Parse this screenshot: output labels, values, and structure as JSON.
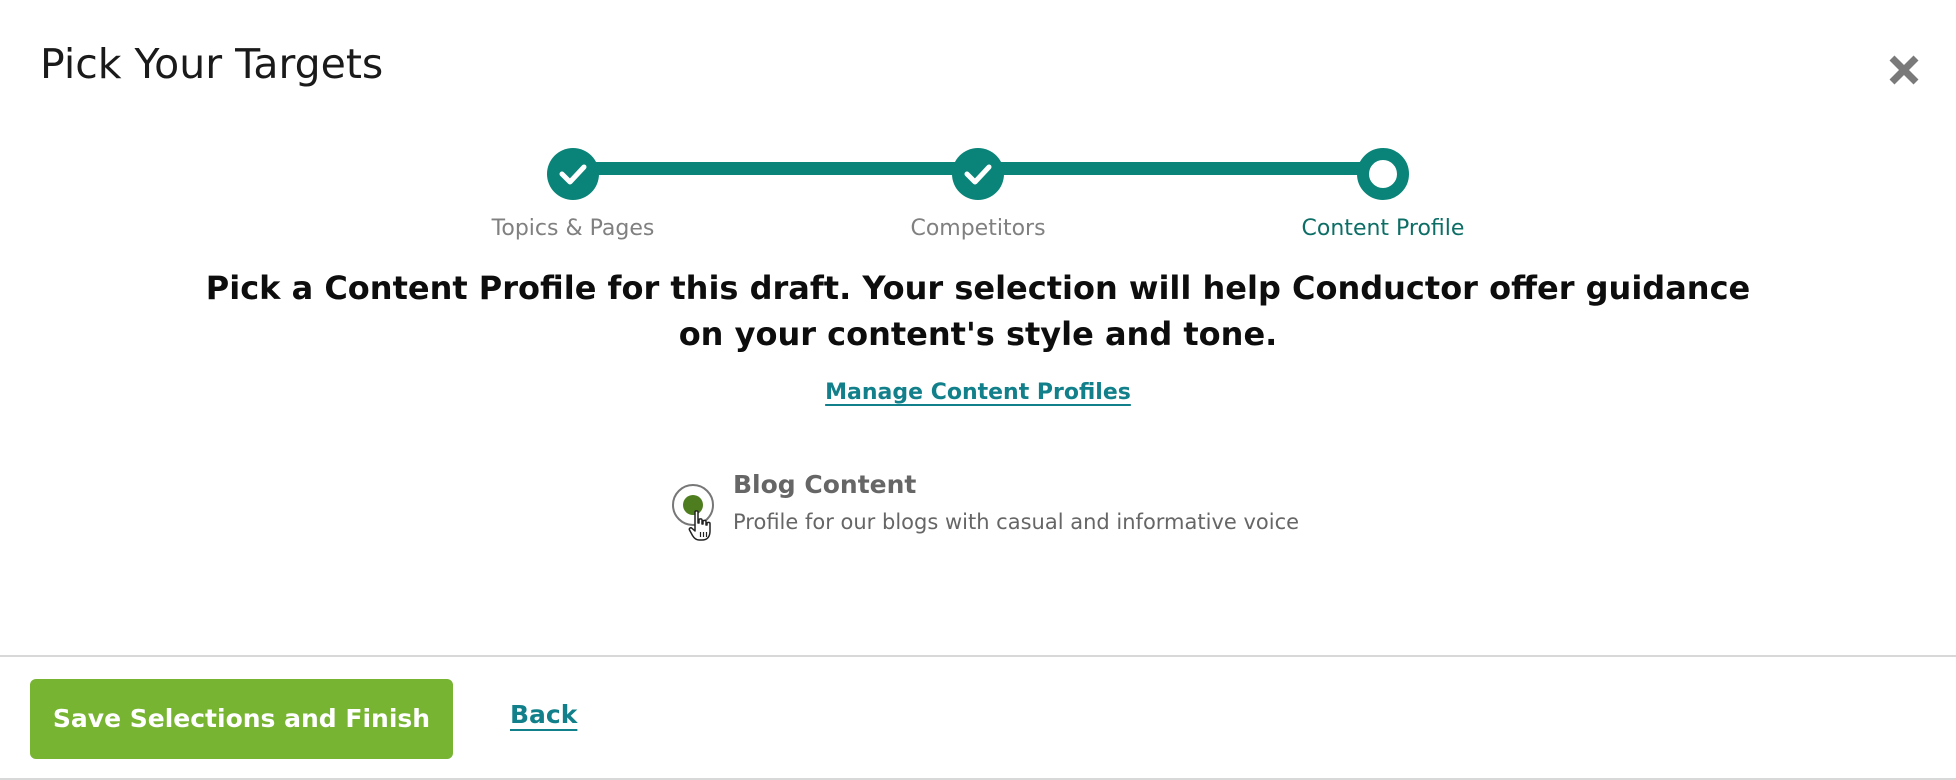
{
  "dialog": {
    "title": "Pick Your Targets",
    "close_icon": "close-icon"
  },
  "stepper": {
    "steps": [
      {
        "label": "Topics & Pages",
        "status": "complete"
      },
      {
        "label": "Competitors",
        "status": "complete"
      },
      {
        "label": "Content Profile",
        "status": "current"
      }
    ],
    "colors": {
      "accent": "#0a8478",
      "current_label": "#0d6e66",
      "inactive_label": "#808080"
    }
  },
  "content": {
    "prompt": "Pick a Content Profile for this draft. Your selection will help Conductor offer guidance on your content's style and tone.",
    "manage_link": "Manage Content Profiles",
    "options": [
      {
        "title": "Blog Content",
        "description": "Profile for our blogs with casual and informative voice",
        "selected": true
      }
    ]
  },
  "footer": {
    "primary_label": "Save Selections and Finish",
    "back_label": "Back",
    "colors": {
      "primary": "#77b432",
      "link": "#12808a"
    }
  }
}
